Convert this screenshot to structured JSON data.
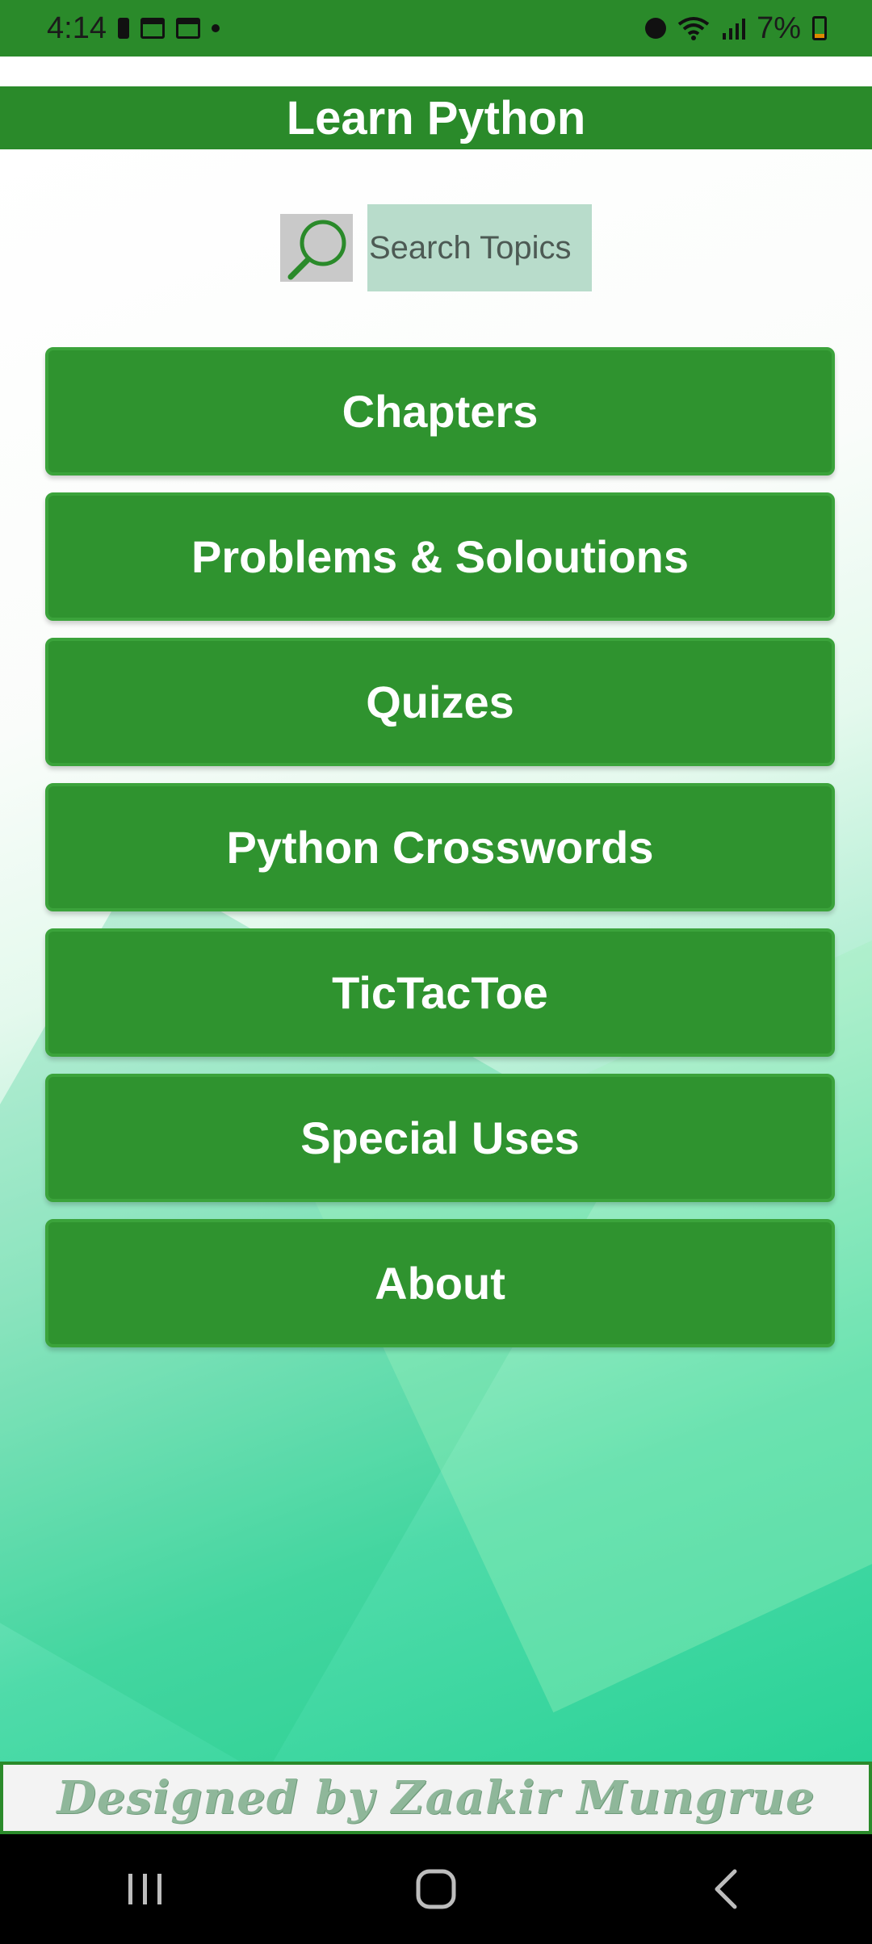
{
  "status_bar": {
    "time": "4:14",
    "battery_percent": "7%"
  },
  "app": {
    "title": "Learn Python"
  },
  "search": {
    "placeholder": "Search Topics"
  },
  "menu": {
    "items": [
      {
        "label": "Chapters"
      },
      {
        "label": "Problems & Soloutions"
      },
      {
        "label": "Quizes"
      },
      {
        "label": "Python Crosswords"
      },
      {
        "label": "TicTacToe"
      },
      {
        "label": "Special Uses"
      },
      {
        "label": "About"
      }
    ]
  },
  "footer": {
    "credit": "Designed by Zaakir Mungrue"
  },
  "colors": {
    "primary_green": "#2a8a2a",
    "button_green": "#2f932f"
  }
}
